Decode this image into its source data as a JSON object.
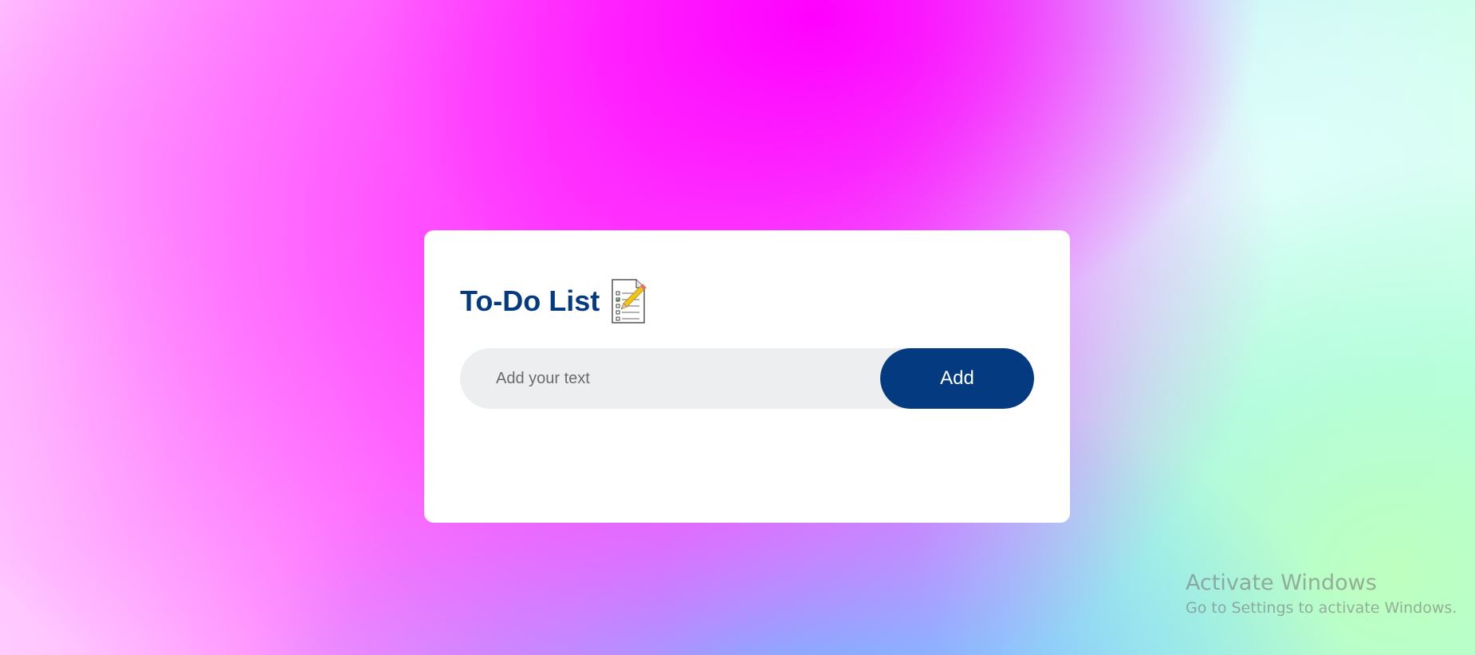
{
  "app": {
    "title": "To-Do List",
    "title_icon": "notepad-with-pencil-icon"
  },
  "input": {
    "placeholder": "Add your text",
    "value": ""
  },
  "buttons": {
    "add_label": "Add"
  },
  "tasks": [],
  "watermark": {
    "title": "Activate Windows",
    "subtitle": "Go to Settings to activate Windows."
  },
  "colors": {
    "accent": "#043b80",
    "card_background": "#ffffff",
    "input_background": "#edeef0"
  }
}
